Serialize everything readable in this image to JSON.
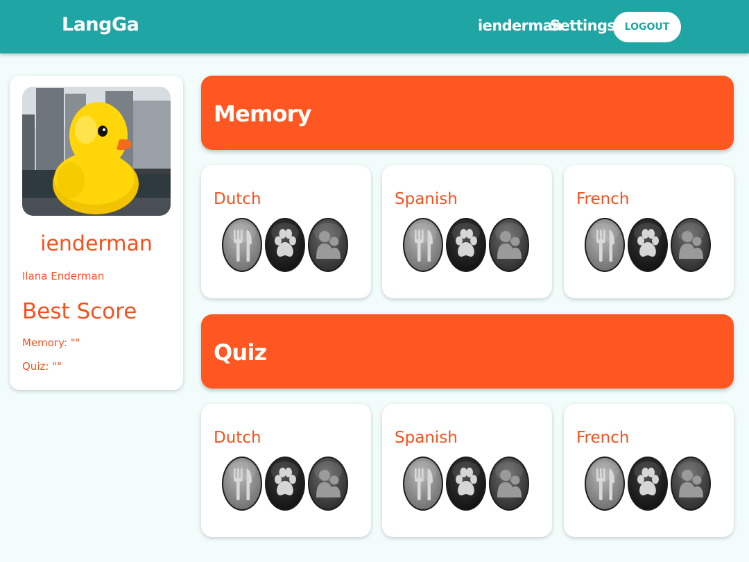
{
  "navbar": {
    "brand": "LangGa",
    "username": "ienderman",
    "settings_label": "Settings",
    "logout_label": "LOGOUT"
  },
  "profile": {
    "username": "ienderman",
    "full_name": "Ilana Enderman",
    "best_score_title": "Best Score",
    "memory_score": "Memory: \"\"",
    "quiz_score": "Quiz: \"\""
  },
  "sections": [
    {
      "title": "Memory",
      "languages": [
        {
          "name": "Dutch"
        },
        {
          "name": "Spanish"
        },
        {
          "name": "French"
        }
      ]
    },
    {
      "title": "Quiz",
      "languages": [
        {
          "name": "Dutch"
        },
        {
          "name": "Spanish"
        },
        {
          "name": "French"
        }
      ]
    }
  ],
  "category_icons": [
    "cutlery-icon",
    "paw-icon",
    "people-icon"
  ],
  "colors": {
    "navbar": "#1fa6a4",
    "accent": "#ff5722",
    "text_accent": "#f4511e",
    "background": "#f1fcfb"
  }
}
